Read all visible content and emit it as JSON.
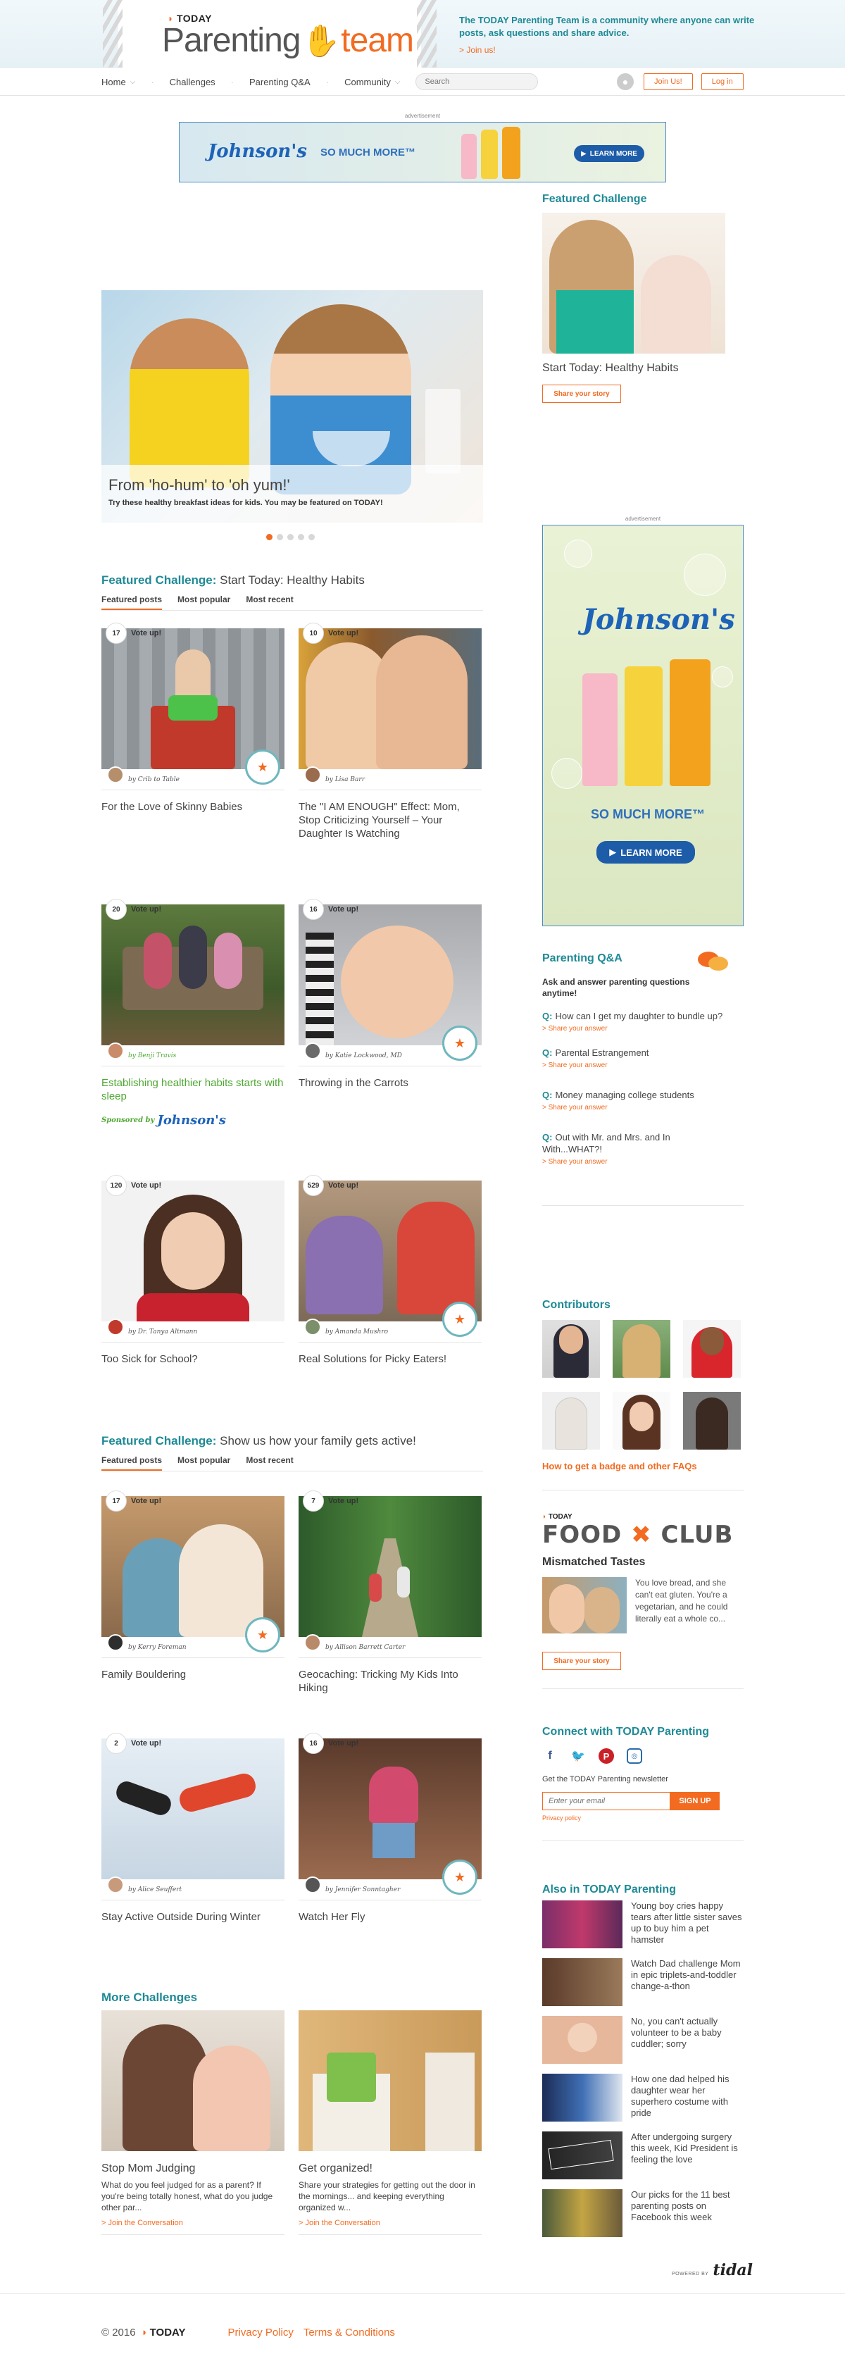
{
  "header": {
    "logo_today": "TODAY",
    "logo_parenting": "Parenting",
    "logo_team": "team",
    "tagline": "The TODAY Parenting Team is a community where anyone can write posts, ask questions and share advice.",
    "join": "> Join us!"
  },
  "nav": {
    "items": [
      "Home",
      "Challenges",
      "Parenting Q&A",
      "Community"
    ],
    "search_placeholder": "Search",
    "join_btn": "Join Us!",
    "login_btn": "Log in"
  },
  "ads": {
    "label": "advertisement",
    "brand": "Johnson's",
    "headline": "SO MUCH MORE™",
    "cta": "LEARN MORE"
  },
  "hero": {
    "title": "From 'ho-hum' to 'oh yum!'",
    "subtitle": "Try these healthy breakfast ideas for kids. You may be featured on TODAY!",
    "slides": 5
  },
  "challenge1": {
    "prefix": "Featured Challenge:",
    "title": "Start Today: Healthy Habits",
    "tabs": [
      "Featured posts",
      "Most popular",
      "Most recent"
    ],
    "vote_label": "Vote up!",
    "cards": [
      {
        "votes": "17",
        "author": "by Crib to Table",
        "title": "For the Love of Skinny Babies"
      },
      {
        "votes": "10",
        "author": "by Lisa Barr",
        "title": "The \"I AM ENOUGH\" Effect: Mom, Stop Criticizing Yourself – Your Daughter Is Watching"
      },
      {
        "votes": "20",
        "author": "by Benji Travis",
        "title": "Establishing healthier habits starts with sleep"
      },
      {
        "votes": "16",
        "author": "by Katie Lockwood, MD",
        "title": "Throwing in the Carrots"
      },
      {
        "votes": "120",
        "author": "by Dr. Tanya Altmann",
        "title": "Too Sick for School?"
      },
      {
        "votes": "529",
        "author": "by Amanda Mushro",
        "title": "Real Solutions for Picky Eaters!"
      }
    ],
    "sponsored_label": "Sponsored by",
    "sponsor": "Johnson's"
  },
  "challenge2": {
    "prefix": "Featured Challenge:",
    "title": "Show us how your family gets active!",
    "tabs": [
      "Featured posts",
      "Most popular",
      "Most recent"
    ],
    "vote_label": "Vote up!",
    "cards": [
      {
        "votes": "17",
        "author": "by Kerry Foreman",
        "title": "Family Bouldering"
      },
      {
        "votes": "7",
        "author": "by Allison Barrett Carter",
        "title": "Geocaching: Tricking My Kids Into Hiking"
      },
      {
        "votes": "2",
        "author": "by Alice Seuffert",
        "title": "Stay Active Outside During Winter"
      },
      {
        "votes": "16",
        "author": "by Jennifer Sonntagher",
        "title": "Watch Her Fly"
      }
    ]
  },
  "more": {
    "heading": "More Challenges",
    "items": [
      {
        "title": "Stop Mom Judging",
        "desc": "What do you feel judged for as a parent? If you're being totally honest, what do you judge other par...",
        "link": "> Join the Conversation"
      },
      {
        "title": "Get organized!",
        "desc": "Share your strategies for getting out the door in the mornings... and keeping everything organized w...",
        "link": "> Join the Conversation"
      }
    ]
  },
  "sidebar": {
    "featured_heading": "Featured Challenge",
    "featured_title": "Start Today: Healthy Habits",
    "share_btn": "Share your story",
    "qa_heading": "Parenting Q&A",
    "qa_intro": "Ask and answer parenting questions anytime!",
    "qa_q": "Q:",
    "qa_share": "> Share your answer",
    "questions": [
      "How can I get my daughter to bundle up?",
      "Parental Estrangement",
      "Money managing college students",
      "Out with Mr. and Mrs. and In With...WHAT?!"
    ],
    "contributors_heading": "Contributors",
    "faq_link": "How to get a badge and other FAQs",
    "food_today": "TODAY",
    "food_logo_1": "FOOD",
    "food_logo_2": "CLUB",
    "mt_title": "Mismatched Tastes",
    "mt_text": "You love bread, and she can't eat gluten. You're a vegetarian, and he could literally eat a whole co...",
    "connect_heading": "Connect with TODAY Parenting",
    "newsletter_label": "Get the TODAY Parenting newsletter",
    "email_placeholder": "Enter your email",
    "signup_btn": "SIGN UP",
    "privacy": "Privacy policy",
    "also_heading": "Also in TODAY Parenting",
    "also_items": [
      "Young boy cries happy tears after little sister saves up to buy him a pet hamster",
      "Watch Dad challenge Mom in epic triplets-and-toddler change-a-thon",
      "No, you can't actually volunteer to be a baby cuddler; sorry",
      "How one dad helped his daughter wear her superhero costume with pride",
      "After undergoing surgery this week, Kid President is feeling the love",
      "Our picks for the 11 best parenting posts on Facebook this week"
    ]
  },
  "powered": {
    "label": "powered by",
    "brand": "tidal"
  },
  "footer": {
    "copyright": "© 2016",
    "today": "TODAY",
    "privacy": "Privacy Policy",
    "terms": "Terms & Conditions"
  }
}
